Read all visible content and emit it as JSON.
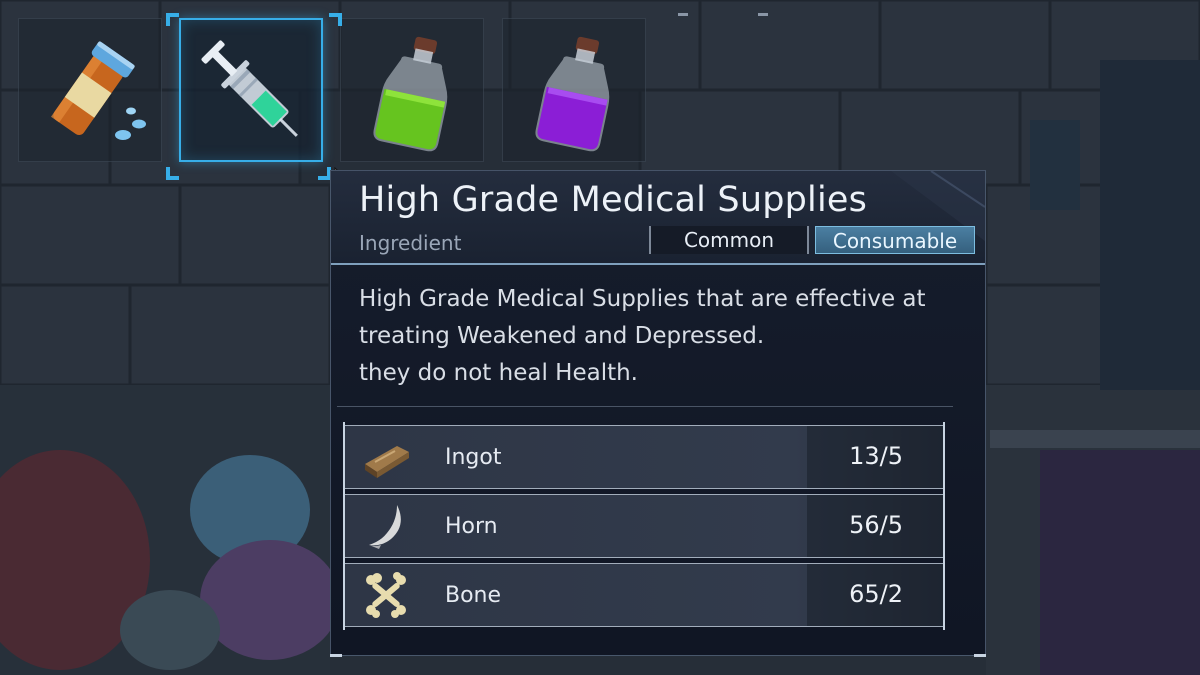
{
  "inventory": {
    "slots": [
      {
        "item_icon": "pill-bottle-icon",
        "selected": false
      },
      {
        "item_icon": "syringe-icon",
        "selected": true
      },
      {
        "item_icon": "green-potion-icon",
        "selected": false
      },
      {
        "item_icon": "purple-potion-icon",
        "selected": false
      }
    ]
  },
  "tooltip": {
    "title": "High Grade Medical Supplies",
    "subtype": "Ingredient",
    "badges": [
      "Common",
      "Consumable"
    ],
    "description": [
      "High Grade Medical Supplies that are effective at",
      "treating Weakened and Depressed.",
      "they do not heal Health."
    ],
    "materials": [
      {
        "name": "Ingot",
        "qty": "13/5",
        "icon": "ingot-icon"
      },
      {
        "name": "Horn",
        "qty": "56/5",
        "icon": "horn-icon"
      },
      {
        "name": "Bone",
        "qty": "65/2",
        "icon": "bone-icon"
      }
    ]
  },
  "colors": {
    "accent": "#37aee8",
    "panel": "#131a28",
    "consumable_badge": "#3f7193"
  }
}
